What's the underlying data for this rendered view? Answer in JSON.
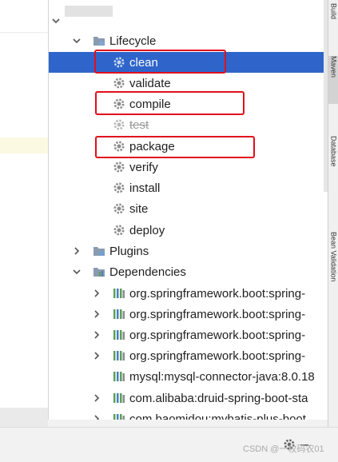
{
  "tree": {
    "lifecycle": {
      "label": "Lifecycle",
      "phases": [
        {
          "label": "clean",
          "selected": true,
          "disabled": false,
          "highlighted": true
        },
        {
          "label": "validate",
          "selected": false,
          "disabled": false,
          "highlighted": false
        },
        {
          "label": "compile",
          "selected": false,
          "disabled": false,
          "highlighted": true
        },
        {
          "label": "test",
          "selected": false,
          "disabled": true,
          "highlighted": false
        },
        {
          "label": "package",
          "selected": false,
          "disabled": false,
          "highlighted": true
        },
        {
          "label": "verify",
          "selected": false,
          "disabled": false,
          "highlighted": false
        },
        {
          "label": "install",
          "selected": false,
          "disabled": false,
          "highlighted": false
        },
        {
          "label": "site",
          "selected": false,
          "disabled": false,
          "highlighted": false
        },
        {
          "label": "deploy",
          "selected": false,
          "disabled": false,
          "highlighted": false
        }
      ]
    },
    "plugins": {
      "label": "Plugins"
    },
    "dependencies": {
      "label": "Dependencies",
      "items": [
        {
          "label": "org.springframework.boot:spring-",
          "expandable": true
        },
        {
          "label": "org.springframework.boot:spring-",
          "expandable": true
        },
        {
          "label": "org.springframework.boot:spring-",
          "expandable": true
        },
        {
          "label": "org.springframework.boot:spring-",
          "expandable": true
        },
        {
          "label": "mysql:mysql-connector-java:8.0.18",
          "expandable": false
        },
        {
          "label": "com.alibaba:druid-spring-boot-sta",
          "expandable": true
        },
        {
          "label": "com.baomidou:mybatis-plus-boot",
          "expandable": true
        }
      ]
    }
  },
  "side_tabs": [
    "Build",
    "Maven",
    "Database",
    "Bean Validation"
  ],
  "watermark": "CSDN @一枚码农01",
  "colors": {
    "selection": "#2f65ca",
    "highlight_box": "#e0101b",
    "folder_icon": "#8a9bb0",
    "gear_icon": "#8c8c8c",
    "library_icon": "#5aa05a"
  }
}
